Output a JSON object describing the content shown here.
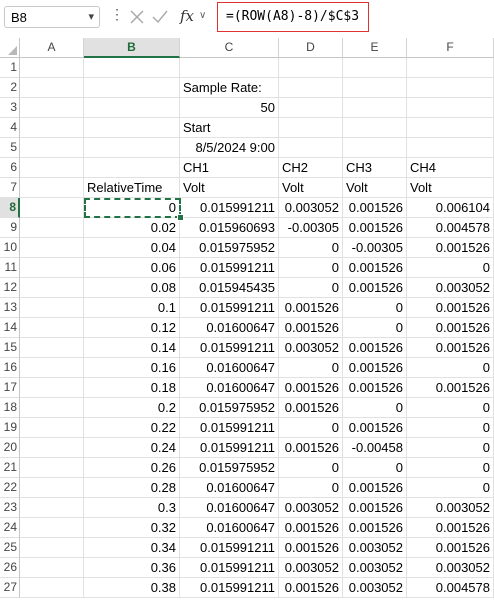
{
  "formula_bar": {
    "name_box": "B8",
    "formula": "=(ROW(A8)-8)/$C$3"
  },
  "columns": [
    "A",
    "B",
    "C",
    "D",
    "E",
    "F"
  ],
  "selected_column": "B",
  "selected_row": 8,
  "row_numbers": [
    "1",
    "2",
    "3",
    "4",
    "5",
    "6",
    "7",
    "8",
    "9",
    "10",
    "11",
    "12",
    "13",
    "14",
    "15",
    "16",
    "17",
    "18",
    "19",
    "20",
    "21",
    "22",
    "23",
    "24",
    "25",
    "26",
    "27"
  ],
  "rows": [
    {
      "A": "",
      "B": "",
      "C": "",
      "D": "",
      "E": "",
      "F": ""
    },
    {
      "A": "",
      "B": "",
      "C": "Sample Rate:",
      "D": "",
      "E": "",
      "F": ""
    },
    {
      "A": "",
      "B": "",
      "C": "50",
      "D": "",
      "E": "",
      "F": ""
    },
    {
      "A": "",
      "B": "",
      "C": "Start",
      "D": "",
      "E": "",
      "F": ""
    },
    {
      "A": "",
      "B": "",
      "C": "8/5/2024 9:00",
      "D": "",
      "E": "",
      "F": ""
    },
    {
      "A": "",
      "B": "",
      "C": "CH1",
      "D": "CH2",
      "E": "CH3",
      "F": "CH4"
    },
    {
      "A": "",
      "B": "RelativeTime",
      "C": "Volt",
      "D": "Volt",
      "E": "Volt",
      "F": "Volt"
    },
    {
      "A": "",
      "B": "0",
      "C": "0.015991211",
      "D": "0.003052",
      "E": "0.001526",
      "F": "0.006104"
    },
    {
      "A": "",
      "B": "0.02",
      "C": "0.015960693",
      "D": "-0.00305",
      "E": "0.001526",
      "F": "0.004578"
    },
    {
      "A": "",
      "B": "0.04",
      "C": "0.015975952",
      "D": "0",
      "E": "-0.00305",
      "F": "0.001526"
    },
    {
      "A": "",
      "B": "0.06",
      "C": "0.015991211",
      "D": "0",
      "E": "0.001526",
      "F": "0"
    },
    {
      "A": "",
      "B": "0.08",
      "C": "0.015945435",
      "D": "0",
      "E": "0.001526",
      "F": "0.003052"
    },
    {
      "A": "",
      "B": "0.1",
      "C": "0.015991211",
      "D": "0.001526",
      "E": "0",
      "F": "0.001526"
    },
    {
      "A": "",
      "B": "0.12",
      "C": "0.01600647",
      "D": "0.001526",
      "E": "0",
      "F": "0.001526"
    },
    {
      "A": "",
      "B": "0.14",
      "C": "0.015991211",
      "D": "0.003052",
      "E": "0.001526",
      "F": "0.001526"
    },
    {
      "A": "",
      "B": "0.16",
      "C": "0.01600647",
      "D": "0",
      "E": "0.001526",
      "F": "0"
    },
    {
      "A": "",
      "B": "0.18",
      "C": "0.01600647",
      "D": "0.001526",
      "E": "0.001526",
      "F": "0.001526"
    },
    {
      "A": "",
      "B": "0.2",
      "C": "0.015975952",
      "D": "0.001526",
      "E": "0",
      "F": "0"
    },
    {
      "A": "",
      "B": "0.22",
      "C": "0.015991211",
      "D": "0",
      "E": "0.001526",
      "F": "0"
    },
    {
      "A": "",
      "B": "0.24",
      "C": "0.015991211",
      "D": "0.001526",
      "E": "-0.00458",
      "F": "0"
    },
    {
      "A": "",
      "B": "0.26",
      "C": "0.015975952",
      "D": "0",
      "E": "0",
      "F": "0"
    },
    {
      "A": "",
      "B": "0.28",
      "C": "0.01600647",
      "D": "0",
      "E": "0.001526",
      "F": "0"
    },
    {
      "A": "",
      "B": "0.3",
      "C": "0.01600647",
      "D": "0.003052",
      "E": "0.001526",
      "F": "0.003052"
    },
    {
      "A": "",
      "B": "0.32",
      "C": "0.01600647",
      "D": "0.001526",
      "E": "0.001526",
      "F": "0.001526"
    },
    {
      "A": "",
      "B": "0.34",
      "C": "0.015991211",
      "D": "0.001526",
      "E": "0.003052",
      "F": "0.001526"
    },
    {
      "A": "",
      "B": "0.36",
      "C": "0.015991211",
      "D": "0.003052",
      "E": "0.003052",
      "F": "0.003052"
    },
    {
      "A": "",
      "B": "0.38",
      "C": "0.015991211",
      "D": "0.001526",
      "E": "0.003052",
      "F": "0.004578"
    }
  ],
  "colors": {
    "selection_accent": "#217346",
    "formula_highlight": "#dd3333"
  }
}
